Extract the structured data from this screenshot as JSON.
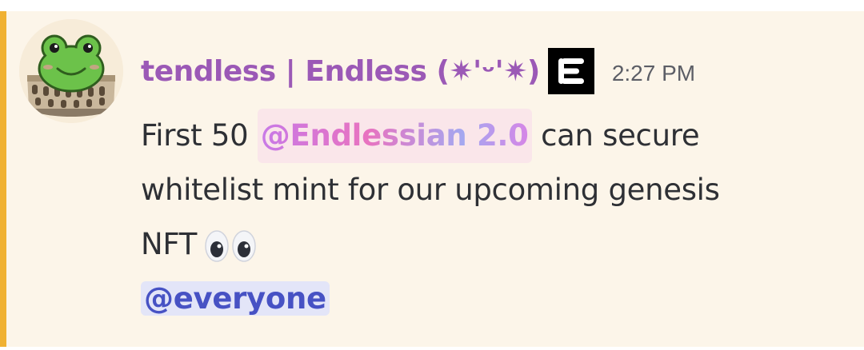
{
  "message": {
    "author": "tendless | Endless (✷'ᵕ'✷)",
    "timestamp": "2:27 PM",
    "author_color": "#9b59b6",
    "highlight_color": "#f0b132",
    "role_icon": "endless-logo-icon",
    "avatar": "frog-colosseum-avatar",
    "content": {
      "line1_prefix": "First 50 ",
      "role_mention": "@Endlessian 2.0",
      "line1_suffix": " can secure",
      "line2": "whitelist mint for our upcoming genesis",
      "line3": "NFT",
      "emoji": "eyes-emoji",
      "everyone_mention": "@everyone"
    }
  }
}
